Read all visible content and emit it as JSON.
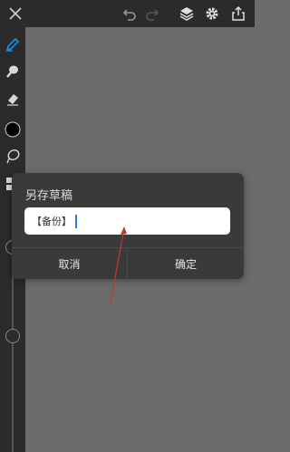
{
  "toolbar": {
    "close_icon": "close-icon",
    "undo_icon": "undo-icon",
    "redo_icon": "redo-icon",
    "layers_icon": "layers-icon",
    "settings_icon": "gear-icon",
    "share_icon": "share-icon"
  },
  "sidebar": {
    "tools": [
      "pen-icon",
      "brush-icon",
      "eraser-icon",
      "color-swatch",
      "lasso-icon",
      "grid-icon"
    ],
    "active_tool_color": "#1e8fe0"
  },
  "dialog": {
    "title": "另存草稿",
    "input_value": "【备份】",
    "cancel_label": "取消",
    "confirm_label": "确定"
  },
  "colors": {
    "canvas": "#6b6b6b",
    "chrome": "#2b2b2b",
    "dialog": "#3a3a3a",
    "annotation_arrow": "#c0392b"
  }
}
